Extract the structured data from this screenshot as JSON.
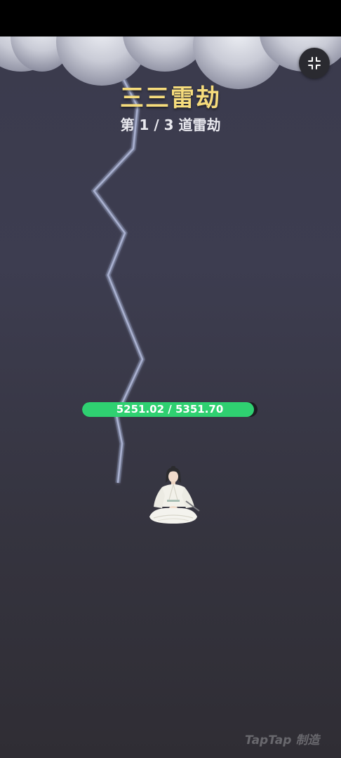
{
  "game": {
    "title": "三三雷劫",
    "subtitle": "第 1 / 3 道雷劫"
  },
  "health": {
    "current": 5251.02,
    "max": 5351.7,
    "text": "5251.02 / 5351.70",
    "fill_percent": 98.1,
    "color": "#2fd071"
  },
  "controls": {
    "exit_fullscreen_icon": "collapse-arrows-icon"
  },
  "watermark": {
    "text": "TapTap 制造"
  },
  "colors": {
    "title": "#f6dc7c",
    "background": "#3a3a4c",
    "lightning": "#9aa3c8"
  }
}
